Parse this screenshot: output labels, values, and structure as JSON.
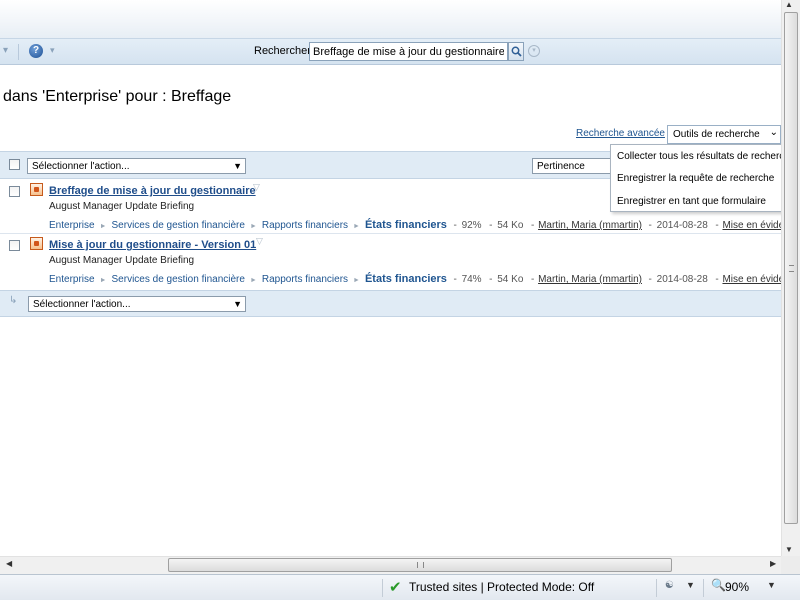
{
  "toolbar": {
    "search_label": "Rechercher",
    "search_value": "Breffage de mise à jour du gestionnaire"
  },
  "results_header": {
    "title": "dans 'Enterprise' pour : Breffage",
    "advanced_search_link": "Recherche avancée",
    "search_tools_select": "Outils de recherche"
  },
  "action_bar": {
    "select_action": "Sélectionner l'action...",
    "sort_by": "Pertinence"
  },
  "results": [
    {
      "title": "Breffage de mise à jour du gestionnaire",
      "description": "August Manager Update Briefing",
      "breadcrumb": [
        "Enterprise",
        "Services de gestion financière",
        "Rapports financiers",
        "États financiers"
      ],
      "relevance": "92%",
      "size": "54 Ko",
      "author": "Martin, Maria (mmartin)",
      "date": "2014-08-28",
      "highlight_link": "Mise en évidence des ré"
    },
    {
      "title": "Mise à jour du gestionnaire - Version 01",
      "description": "August Manager Update Briefing",
      "breadcrumb": [
        "Enterprise",
        "Services de gestion financière",
        "Rapports financiers",
        "États financiers"
      ],
      "relevance": "74%",
      "size": "54 Ko",
      "author": "Martin, Maria (mmartin)",
      "date": "2014-08-28",
      "highlight_link": "Mise en évidence des ré"
    }
  ],
  "bottom_bar": {
    "select_action": "Sélectionner l'action..."
  },
  "tools_menu": {
    "items": [
      "Collecter tous les résultats de recherche",
      "Enregistrer la requête de recherche",
      "Enregistrer en tant que formulaire"
    ]
  },
  "statusbar": {
    "zone": "Trusted sites | Protected Mode: Off",
    "zoom": "90%"
  },
  "icons": {
    "help": "help-icon",
    "search": "search-icon",
    "document": "document-icon",
    "check": "check-icon",
    "zoom": "zoom-icon"
  },
  "colors": {
    "link": "#1f4d8a",
    "toolbar_bg": "#d5e3f0",
    "action_bar_bg": "#e0ebf5",
    "status_check": "#2a9a2a"
  }
}
